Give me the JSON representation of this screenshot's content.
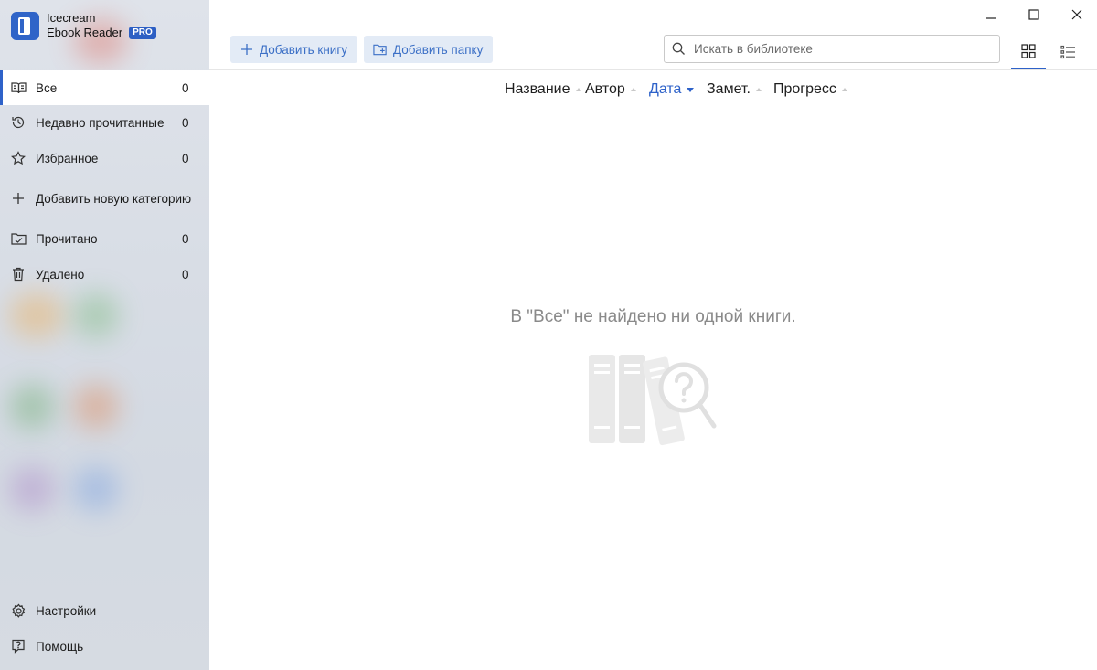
{
  "app": {
    "name_line1": "Icecream",
    "name_line2": "Ebook Reader",
    "badge": "PRO",
    "accent": "#2e62c9"
  },
  "sidebar": {
    "items": [
      {
        "label": "Все",
        "count": "0",
        "icon": "book-open-icon",
        "active": true
      },
      {
        "label": "Недавно прочитанные",
        "count": "0",
        "icon": "history-icon"
      },
      {
        "label": "Избранное",
        "count": "0",
        "icon": "star-icon"
      },
      {
        "label": "Добавить новую категорию",
        "count": "",
        "icon": "plus-icon"
      },
      {
        "label": "Прочитано",
        "count": "0",
        "icon": "folder-check-icon"
      },
      {
        "label": "Удалено",
        "count": "0",
        "icon": "trash-icon"
      }
    ],
    "bottom": [
      {
        "label": "Настройки",
        "icon": "gear-icon"
      },
      {
        "label": "Помощь",
        "icon": "help-icon"
      }
    ]
  },
  "toolbar": {
    "add_book": "Добавить книгу",
    "add_folder": "Добавить папку",
    "search_placeholder": "Искать в библиотеке"
  },
  "sort": {
    "columns": [
      "Название",
      "Автор",
      "Дата",
      "Замет.",
      "Прогресс"
    ],
    "active": "Дата"
  },
  "empty": {
    "message": "В \"Все\" не найдено ни одной книги."
  }
}
